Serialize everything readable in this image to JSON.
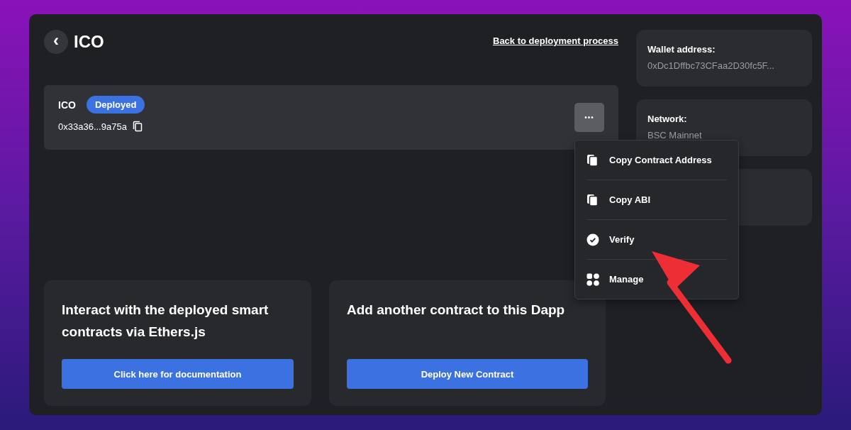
{
  "header": {
    "back_button": "‹",
    "title": "ICO",
    "link": "Back to deployment process"
  },
  "contract": {
    "name": "ICO",
    "status": "Deployed",
    "address": "0x33a36...9a75a",
    "more_button": "•••"
  },
  "menu": {
    "items": [
      {
        "label": "Copy Contract Address",
        "kind": "copy"
      },
      {
        "label": "Copy ABI",
        "kind": "copy"
      },
      {
        "label": "Verify",
        "kind": "check"
      },
      {
        "label": "Manage",
        "kind": "grid"
      }
    ]
  },
  "cards": [
    {
      "title": "Interact with the deployed smart contracts via Ethers.js",
      "button": "Click here for documentation"
    },
    {
      "title": "Add another contract to this Dapp",
      "button": "Deploy New Contract"
    }
  ],
  "info": [
    {
      "kind": "text",
      "label": "Wallet address:",
      "value": "0xDc1Dffbc73CFaa2D30fc5F..."
    },
    {
      "kind": "text",
      "label": "Network:",
      "value": "BSC Mainnet"
    },
    {
      "kind": "blank"
    }
  ],
  "annotations": [
    {
      "kind": "arrow"
    }
  ]
}
